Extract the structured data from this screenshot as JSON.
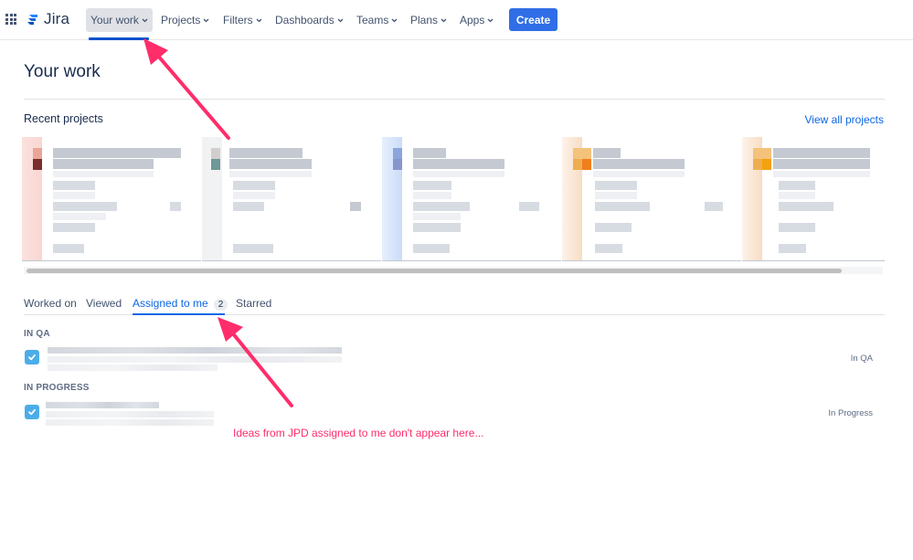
{
  "app": {
    "name": "Jira",
    "accent_color": "#0c66e4",
    "annotation_color": "#ff2d6a"
  },
  "nav": {
    "items": [
      {
        "label": "Your work",
        "active": true
      },
      {
        "label": "Projects",
        "active": false
      },
      {
        "label": "Filters",
        "active": false
      },
      {
        "label": "Dashboards",
        "active": false
      },
      {
        "label": "Teams",
        "active": false
      },
      {
        "label": "Plans",
        "active": false
      },
      {
        "label": "Apps",
        "active": false
      }
    ],
    "create_label": "Create"
  },
  "page": {
    "title": "Your work",
    "recent_projects_title": "Recent projects",
    "view_all_label": "View all projects",
    "project_cards": [
      {
        "color": "#f5a8a0",
        "accent": "#7a2e2e",
        "name": "[redacted]"
      },
      {
        "color": "#eef0f3",
        "accent": "#6f9896",
        "name": "[redacted]"
      },
      {
        "color": "#c9dcfb",
        "accent": "#7d97d9",
        "name": "[redacted]"
      },
      {
        "color": "#f8dcc3",
        "accent": "#f07f1e",
        "name": "[redacted]"
      },
      {
        "color": "#f8dcc3",
        "accent": "#f2a20c",
        "name": "[redacted]"
      }
    ]
  },
  "tabs": {
    "items": [
      {
        "label": "Worked on",
        "active": false
      },
      {
        "label": "Viewed",
        "active": false
      },
      {
        "label": "Assigned to me",
        "active": true,
        "badge": "2"
      },
      {
        "label": "Starred",
        "active": false
      }
    ]
  },
  "groups": [
    {
      "label": "IN QA",
      "items": [
        {
          "title": "[redacted]",
          "status": "In QA"
        }
      ]
    },
    {
      "label": "IN PROGRESS",
      "items": [
        {
          "title": "[redacted]",
          "status": "In Progress"
        }
      ]
    }
  ],
  "annotation": {
    "text": "Ideas from JPD assigned to me don't appear here..."
  }
}
